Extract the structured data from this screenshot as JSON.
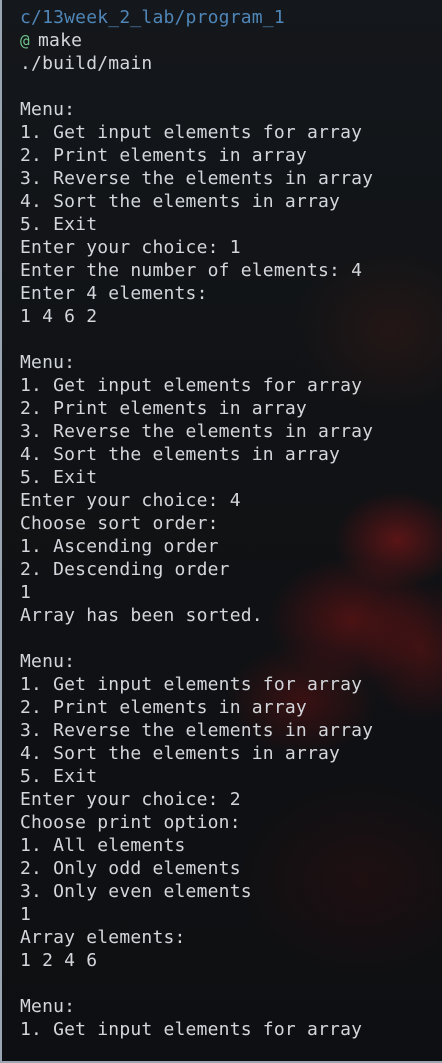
{
  "terminal": {
    "path": "c/13week_2_lab/program_1",
    "prompt_icon": "@",
    "command": "make",
    "output": [
      "./build/main",
      "",
      "Menu:",
      "1. Get input elements for array",
      "2. Print elements in array",
      "3. Reverse the elements in array",
      "4. Sort the elements in array",
      "5. Exit",
      "Enter your choice: 1",
      "Enter the number of elements: 4",
      "Enter 4 elements:",
      "1 4 6 2",
      "",
      "Menu:",
      "1. Get input elements for array",
      "2. Print elements in array",
      "3. Reverse the elements in array",
      "4. Sort the elements in array",
      "5. Exit",
      "Enter your choice: 4",
      "Choose sort order:",
      "1. Ascending order",
      "2. Descending order",
      "1",
      "Array has been sorted.",
      "",
      "Menu:",
      "1. Get input elements for array",
      "2. Print elements in array",
      "3. Reverse the elements in array",
      "4. Sort the elements in array",
      "5. Exit",
      "Enter your choice: 2",
      "Choose print option:",
      "1. All elements",
      "2. Only odd elements",
      "3. Only even elements",
      "1",
      "Array elements:",
      "1 2 4 6",
      "",
      "Menu:",
      "1. Get input elements for array"
    ]
  },
  "colors": {
    "background": "#0d0f12",
    "text": "#d3d6da",
    "path": "#4f86b8",
    "prompt_icon": "#6fc38a",
    "border": "#9aa7b3"
  }
}
